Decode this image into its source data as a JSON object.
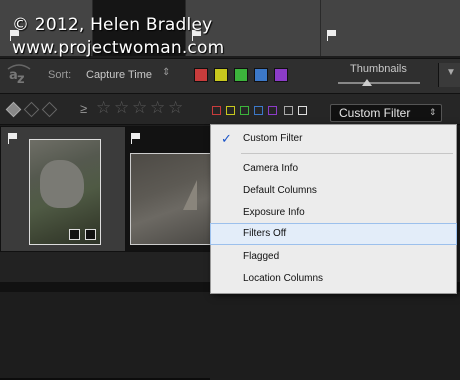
{
  "watermark": {
    "line1": "© 2012, Helen Bradley",
    "line2": "www.projectwoman.com"
  },
  "toolbar": {
    "sort_icon": "sort-az-icon",
    "sort_icon_text": "az",
    "sort_label": "Sort:",
    "sort_value": "Capture Time",
    "color_labels": [
      "#c83c3c",
      "#c8c81e",
      "#3cb43c",
      "#3c78c8",
      "#8c3cc8"
    ],
    "thumbnails_label": "Thumbnails",
    "thumbnails_level": 0.35
  },
  "filterbar": {
    "rating_operator": "≥",
    "stars": [
      "☆",
      "☆",
      "☆",
      "☆",
      "☆"
    ],
    "color_filters": [
      "#c83c3c",
      "#c8c81e",
      "#3cb43c",
      "#3c78c8",
      "#8c3cc8",
      "#aaaaaa",
      "#dddddd"
    ],
    "custom_filter": "Custom Filter"
  },
  "menu": {
    "checked_item": "Custom Filter",
    "items": [
      {
        "label": "Custom Filter",
        "checked": true
      },
      {
        "label": "Camera Info"
      },
      {
        "label": "Default Columns"
      },
      {
        "label": "Exposure Info"
      },
      {
        "label": "Filters Off",
        "highlighted": true
      },
      {
        "label": "Flagged"
      },
      {
        "label": "Location Columns"
      }
    ]
  }
}
